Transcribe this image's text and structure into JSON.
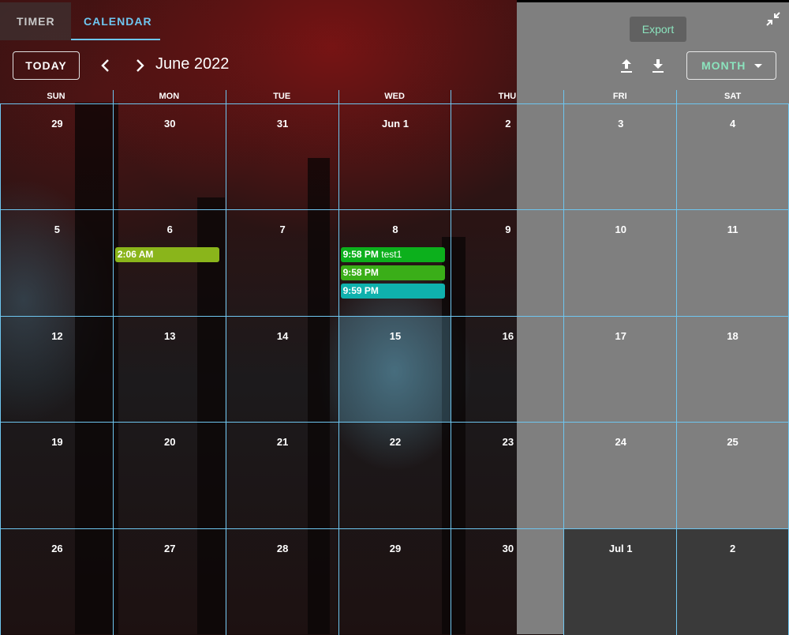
{
  "tabs": [
    {
      "label": "TIMER",
      "active": false
    },
    {
      "label": "CALENDAR",
      "active": true
    }
  ],
  "export_label": "Export",
  "toolbar": {
    "today_label": "TODAY",
    "title": "June 2022",
    "view_label": "MONTH"
  },
  "weekdays": [
    "SUN",
    "MON",
    "TUE",
    "WED",
    "THU",
    "FRI",
    "SAT"
  ],
  "weeks": [
    [
      "29",
      "30",
      "31",
      "Jun 1",
      "2",
      "3",
      "4"
    ],
    [
      "5",
      "6",
      "7",
      "8",
      "9",
      "10",
      "11"
    ],
    [
      "12",
      "13",
      "14",
      "15",
      "16",
      "17",
      "18"
    ],
    [
      "19",
      "20",
      "21",
      "22",
      "23",
      "24",
      "25"
    ],
    [
      "26",
      "27",
      "28",
      "29",
      "30",
      "Jul 1",
      "2"
    ]
  ],
  "events": [
    {
      "week": 2,
      "day": 1,
      "slot": 0,
      "time": "2:06 AM",
      "title": "",
      "color": "#8ab51b"
    },
    {
      "week": 2,
      "day": 3,
      "slot": 0,
      "time": "9:58 PM",
      "title": "test1",
      "color": "#0cb01c"
    },
    {
      "week": 2,
      "day": 3,
      "slot": 1,
      "time": "9:58 PM",
      "title": "",
      "color": "#3aae18"
    },
    {
      "week": 2,
      "day": 3,
      "slot": 2,
      "time": "9:59 PM",
      "title": "",
      "color": "#0fb1ad"
    }
  ],
  "colors": {
    "accent": "#6ec6f0",
    "view_button_text": "#8be3bd",
    "grid_line": "#6ec6f0"
  }
}
